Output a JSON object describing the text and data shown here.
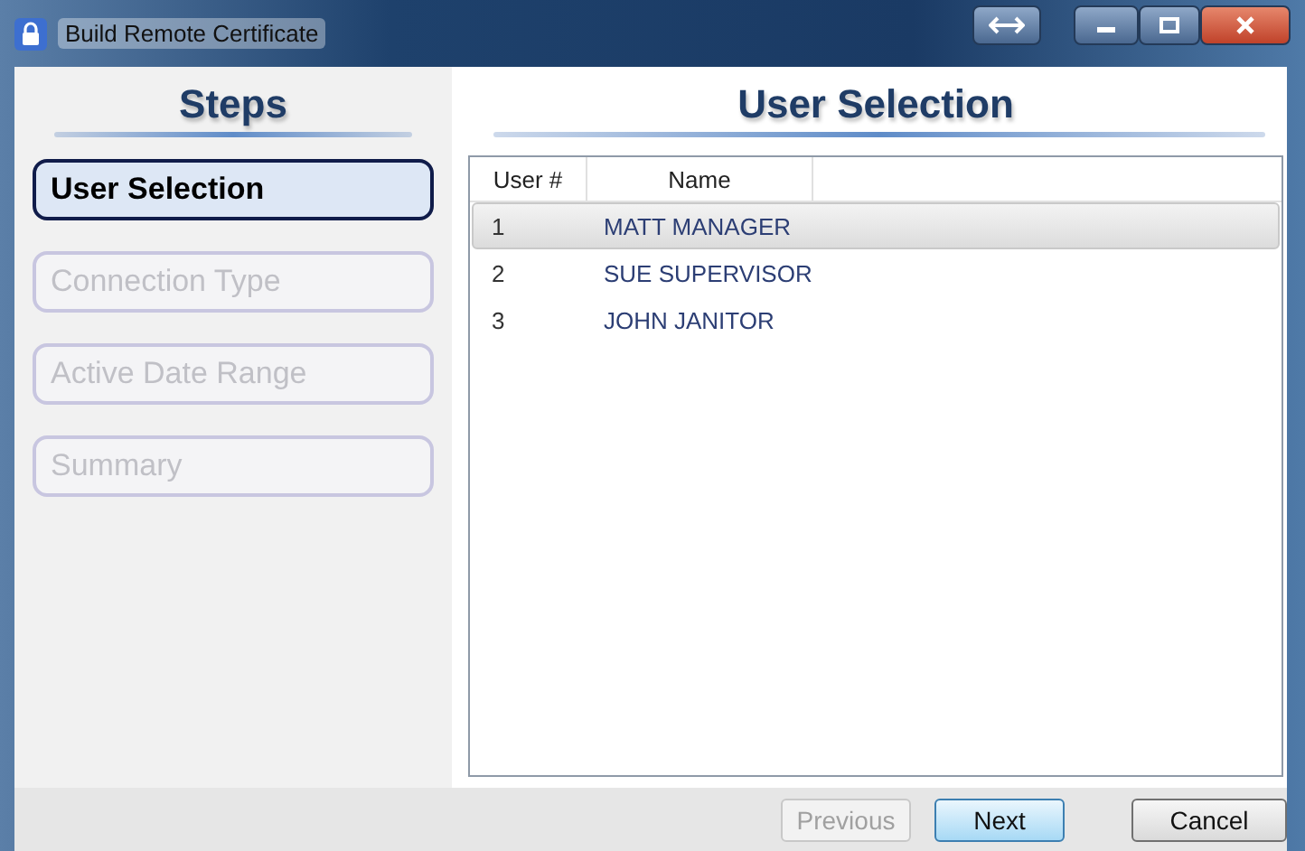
{
  "window": {
    "title": "Build Remote Certificate"
  },
  "steps": {
    "heading": "Steps",
    "items": [
      {
        "label": "User Selection",
        "selected": true
      },
      {
        "label": "Connection Type",
        "selected": false
      },
      {
        "label": "Active Date Range",
        "selected": false
      },
      {
        "label": "Summary",
        "selected": false
      }
    ]
  },
  "content": {
    "heading": "User Selection"
  },
  "table": {
    "columns": [
      "User #",
      "Name"
    ],
    "rows": [
      {
        "cells": [
          "1",
          "MATT MANAGER"
        ],
        "selected": true
      },
      {
        "cells": [
          "2",
          "SUE SUPERVISOR"
        ],
        "selected": false
      },
      {
        "cells": [
          "3",
          "JOHN JANITOR"
        ],
        "selected": false
      }
    ]
  },
  "buttons": [
    {
      "kind": "previous",
      "label": "Previous",
      "disabled": true
    },
    {
      "kind": "next",
      "label": "Next",
      "disabled": false
    },
    {
      "kind": "cancel",
      "label": "Cancel",
      "disabled": false
    }
  ]
}
